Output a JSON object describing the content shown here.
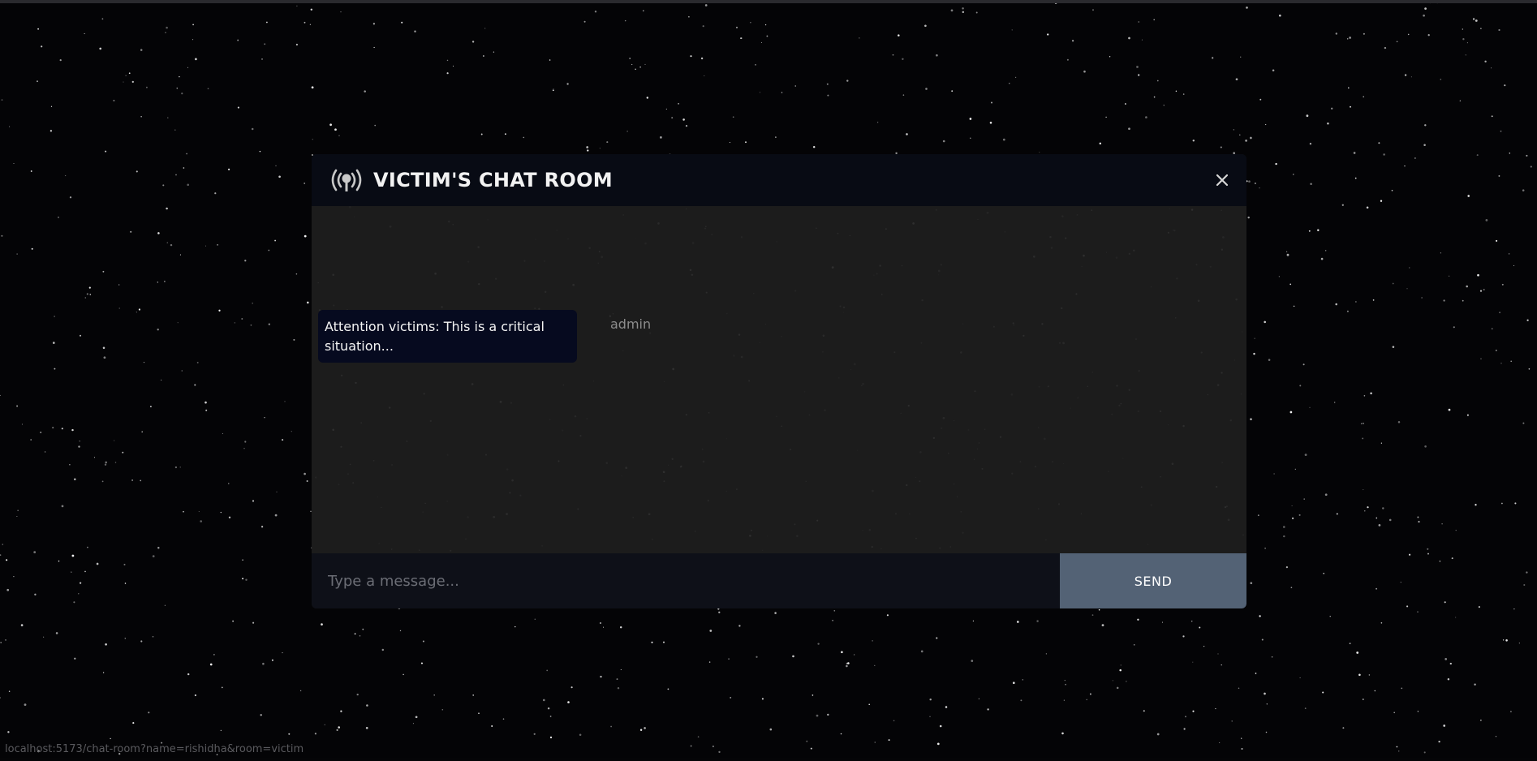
{
  "chat": {
    "title": "VICTIM'S CHAT ROOM",
    "room_icon": "broadcast-icon",
    "close_icon": "close-icon",
    "messages": [
      {
        "text": "Attention victims: This is a critical situation...",
        "sender": "admin"
      }
    ],
    "input": {
      "placeholder": "Type a message...",
      "value": ""
    },
    "send_label": "SEND"
  },
  "status_bar": {
    "url": "localhost:5173/chat-room?name=rishidha&room=victim"
  },
  "colors": {
    "background": "#040406",
    "header": "#080b14",
    "panel": "#1e1e1e",
    "bubble": "#060a1f",
    "send_button": "#536275",
    "sender_text": "#8c8c8c"
  }
}
